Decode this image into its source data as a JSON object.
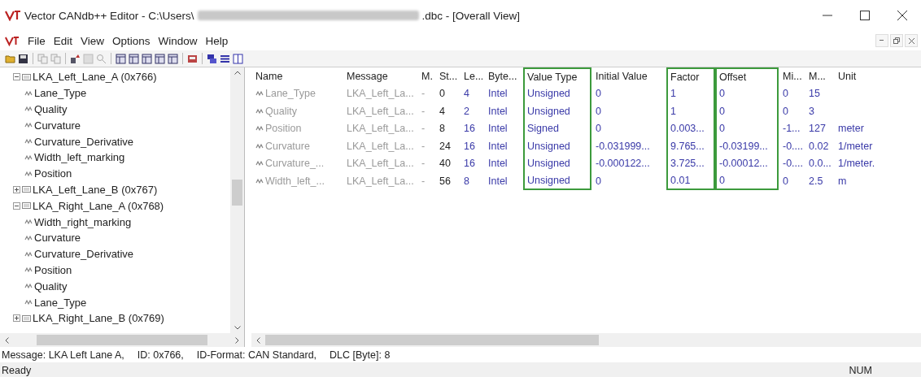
{
  "window": {
    "title_start": "Vector CANdb++ Editor - C:\\Users\\",
    "title_redacted": true,
    "title_end": ".dbc - [Overall View]"
  },
  "menu": [
    "File",
    "Edit",
    "View",
    "Options",
    "Window",
    "Help"
  ],
  "tree": [
    {
      "label": "LKA_Left_Lane_A (0x766)",
      "expanded": true,
      "children": [
        {
          "label": "Lane_Type"
        },
        {
          "label": "Quality"
        },
        {
          "label": "Curvature"
        },
        {
          "label": "Curvature_Derivative"
        },
        {
          "label": "Width_left_marking"
        },
        {
          "label": "Position"
        }
      ]
    },
    {
      "label": "LKA_Left_Lane_B (0x767)",
      "expanded": false
    },
    {
      "label": "LKA_Right_Lane_A (0x768)",
      "expanded": true,
      "children": [
        {
          "label": "Width_right_marking"
        },
        {
          "label": "Curvature"
        },
        {
          "label": "Curvature_Derivative"
        },
        {
          "label": "Position"
        },
        {
          "label": "Quality"
        },
        {
          "label": "Lane_Type"
        }
      ]
    },
    {
      "label": "LKA_Right_Lane_B (0x769)",
      "expanded": false
    }
  ],
  "table": {
    "columns": [
      {
        "label": "Name",
        "kind": "muted",
        "highlighted": false
      },
      {
        "label": "Message",
        "kind": "muted",
        "highlighted": false
      },
      {
        "label": "M.",
        "kind": "muted",
        "highlighted": false
      },
      {
        "label": "St...",
        "kind": "plain",
        "highlighted": false
      },
      {
        "label": "Le...",
        "kind": "blue",
        "highlighted": false
      },
      {
        "label": "Byte...",
        "kind": "blue",
        "highlighted": false
      },
      {
        "label": "Value Type",
        "kind": "blue",
        "highlighted": true
      },
      {
        "label": "Initial Value",
        "kind": "blue",
        "highlighted": false
      },
      {
        "label": "Factor",
        "kind": "blue",
        "highlighted": true
      },
      {
        "label": "Offset",
        "kind": "blue",
        "highlighted": true
      },
      {
        "label": "Mi...",
        "kind": "blue",
        "highlighted": false
      },
      {
        "label": "M...",
        "kind": "blue",
        "highlighted": false
      },
      {
        "label": "Unit",
        "kind": "blue",
        "highlighted": false
      }
    ],
    "rows": [
      [
        "Lane_Type",
        "LKA_Left_La...",
        "-",
        "0",
        "4",
        "Intel",
        "Unsigned",
        "0",
        "1",
        "0",
        "0",
        "15",
        ""
      ],
      [
        "Quality",
        "LKA_Left_La...",
        "-",
        "4",
        "2",
        "Intel",
        "Unsigned",
        "0",
        "1",
        "0",
        "0",
        "3",
        ""
      ],
      [
        "Position",
        "LKA_Left_La...",
        "-",
        "8",
        "16",
        "Intel",
        "Signed",
        "0",
        "0.003...",
        "0",
        "-1...",
        "127",
        "meter"
      ],
      [
        "Curvature",
        "LKA_Left_La...",
        "-",
        "24",
        "16",
        "Intel",
        "Unsigned",
        "-0.031999...",
        "9.765...",
        "-0.03199...",
        "-0....",
        "0.02",
        "1/meter"
      ],
      [
        "Curvature_...",
        "LKA_Left_La...",
        "-",
        "40",
        "16",
        "Intel",
        "Unsigned",
        "-0.000122...",
        "3.725...",
        "-0.00012...",
        "-0....",
        "0.0...",
        "1/meter."
      ],
      [
        "Width_left_...",
        "LKA_Left_La...",
        "-",
        "56",
        "8",
        "Intel",
        "Unsigned",
        "0",
        "0.01",
        "0",
        "0",
        "2.5",
        "m"
      ]
    ]
  },
  "status_bar": {
    "fields": [
      "Message: LKA Left Lane A,",
      "ID: 0x766,",
      "ID-Format: CAN Standard,",
      "DLC [Byte]: 8"
    ],
    "state": "Ready",
    "indicator": "NUM"
  }
}
